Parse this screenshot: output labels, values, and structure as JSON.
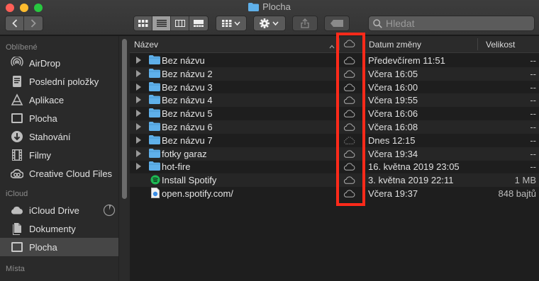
{
  "window": {
    "title": "Plocha"
  },
  "toolbar": {
    "back_icon": "chevron-left-icon",
    "forward_icon": "chevron-right-icon",
    "view_modes": [
      "icon-view",
      "list-view",
      "column-view",
      "gallery-view"
    ],
    "active_view": "list-view",
    "group_icon": "group-grid-icon",
    "action_icon": "gear-icon",
    "share_icon": "share-icon",
    "tag_icon": "tag-icon"
  },
  "search": {
    "placeholder": "Hledat"
  },
  "sidebar": {
    "sections": [
      {
        "title": "Oblíbené"
      },
      {
        "title": "iCloud"
      },
      {
        "title": "Místa"
      }
    ],
    "favorites": [
      {
        "label": "AirDrop",
        "icon": "airdrop-icon"
      },
      {
        "label": "Poslední položky",
        "icon": "recents-icon"
      },
      {
        "label": "Aplikace",
        "icon": "applications-icon"
      },
      {
        "label": "Plocha",
        "icon": "desktop-icon"
      },
      {
        "label": "Stahování",
        "icon": "downloads-icon"
      },
      {
        "label": "Filmy",
        "icon": "movies-icon"
      },
      {
        "label": "Creative Cloud Files",
        "icon": "creative-cloud-icon"
      }
    ],
    "icloud": [
      {
        "label": "iCloud Drive",
        "icon": "cloud-icon"
      },
      {
        "label": "Dokumenty",
        "icon": "documents-icon"
      },
      {
        "label": "Plocha",
        "icon": "desktop-icon",
        "selected": true
      }
    ]
  },
  "columns": {
    "name": "Název",
    "date": "Datum změny",
    "size": "Velikost"
  },
  "files": [
    {
      "name": "Bez názvu",
      "date": "Předevčírem 11:51",
      "size": "--",
      "type": "folder"
    },
    {
      "name": "Bez názvu 2",
      "date": "Včera 16:05",
      "size": "--",
      "type": "folder"
    },
    {
      "name": "Bez názvu 3",
      "date": "Včera 16:00",
      "size": "--",
      "type": "folder"
    },
    {
      "name": "Bez názvu 4",
      "date": "Včera 19:55",
      "size": "--",
      "type": "folder"
    },
    {
      "name": "Bez názvu 5",
      "date": "Včera 16:06",
      "size": "--",
      "type": "folder"
    },
    {
      "name": "Bez názvu 6",
      "date": "Včera 16:08",
      "size": "--",
      "type": "folder"
    },
    {
      "name": "Bez názvu 7",
      "date": "Dnes 12:15",
      "size": "--",
      "type": "folder",
      "cloud": "dotted"
    },
    {
      "name": "fotky garaz",
      "date": "Včera 19:34",
      "size": "--",
      "type": "folder"
    },
    {
      "name": "hot-fire",
      "date": "16. května 2019 23:05",
      "size": "--",
      "type": "folder"
    },
    {
      "name": "Install Spotify",
      "date": "3. května 2019 22:11",
      "size": "1 MB",
      "type": "app"
    },
    {
      "name": "open.spotify.com/",
      "date": "Včera 19:37",
      "size": "848 bajtů",
      "type": "webloc"
    }
  ],
  "colors": {
    "folder": "#5fb0ea",
    "highlight": "#ff2a1a",
    "selected_sidebar": "#464646"
  }
}
